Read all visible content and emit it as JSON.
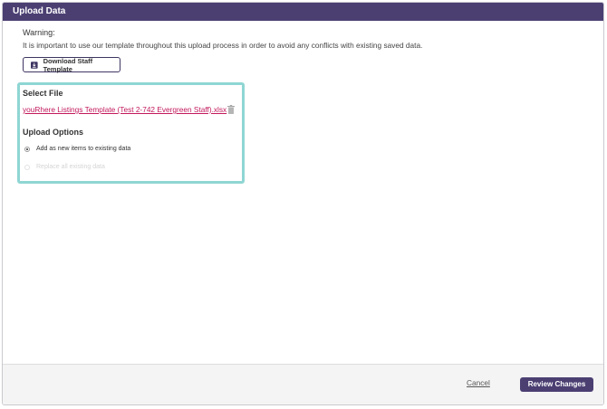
{
  "dialog": {
    "title": "Upload Data"
  },
  "warning": {
    "title": "Warning:",
    "text": "It is important to use our template throughout this upload process in order to avoid any conflicts with existing saved data."
  },
  "download_button": {
    "label": "Download Staff Template",
    "icon": "download-icon"
  },
  "select_file": {
    "label": "Select File",
    "file_name": "youRhere Listings Template (Test 2-742 Evergreen Staff).xlsx",
    "delete_icon": "trash-icon"
  },
  "upload_options": {
    "label": "Upload Options",
    "options": [
      {
        "label": "Add as new items to existing data",
        "selected": true
      },
      {
        "label": "Replace all existing data",
        "selected": false
      }
    ]
  },
  "footer": {
    "cancel_label": "Cancel",
    "review_label": "Review Changes"
  },
  "colors": {
    "header": "#4b3f72",
    "accent_border": "#8fd6d3",
    "link": "#c2185b"
  }
}
